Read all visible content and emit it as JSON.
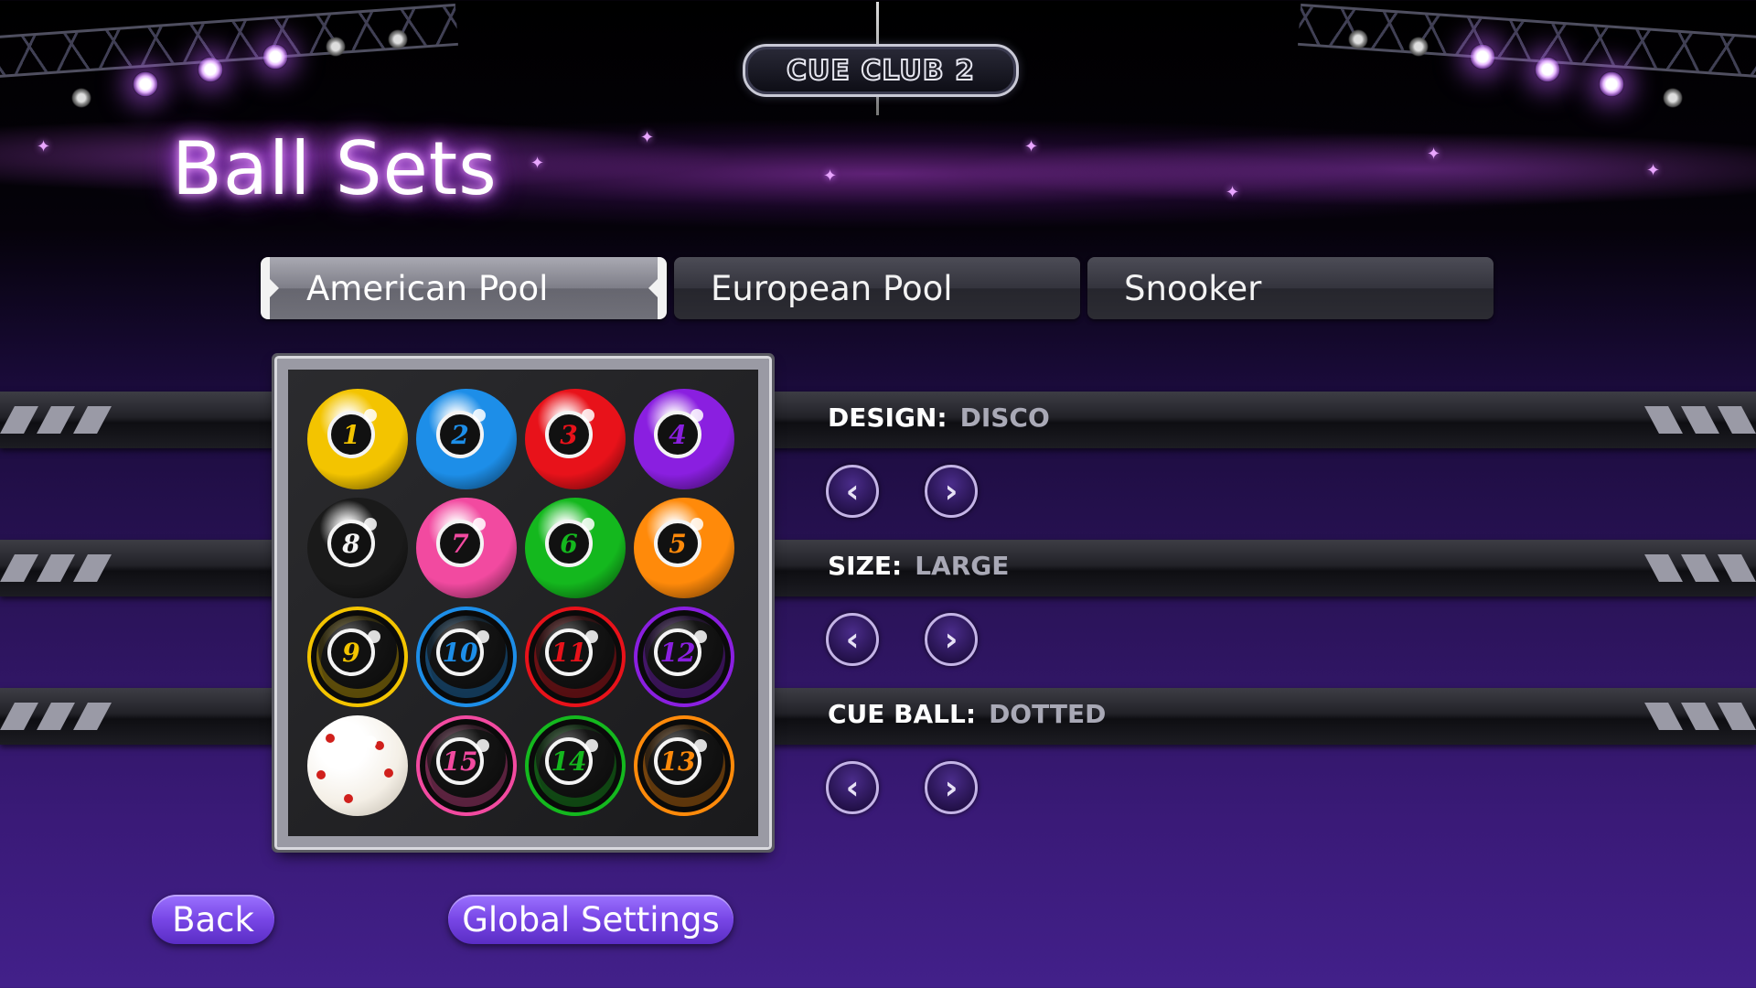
{
  "logo": {
    "text": "CUE CLUB 2"
  },
  "page_title": "Ball Sets",
  "tabs": [
    {
      "label": "American Pool",
      "active": true
    },
    {
      "label": "European Pool",
      "active": false
    },
    {
      "label": "Snooker",
      "active": false
    }
  ],
  "options": {
    "design": {
      "label": "DESIGN:",
      "value": "DISCO"
    },
    "size": {
      "label": "SIZE:",
      "value": "LARGE"
    },
    "cue_ball": {
      "label": "CUE BALL:",
      "value": "DOTTED"
    }
  },
  "arrows": {
    "prev": "‹",
    "next": "›"
  },
  "balls": [
    {
      "num": "1",
      "style": "solid",
      "color": "#f3c400"
    },
    {
      "num": "2",
      "style": "solid",
      "color": "#1d8ee8"
    },
    {
      "num": "3",
      "style": "solid",
      "color": "#e8121a"
    },
    {
      "num": "4",
      "style": "solid",
      "color": "#8a1fe0"
    },
    {
      "num": "8",
      "style": "solid",
      "color": "#1a1a1a"
    },
    {
      "num": "7",
      "style": "solid",
      "color": "#f24aa0"
    },
    {
      "num": "6",
      "style": "solid",
      "color": "#14b81e"
    },
    {
      "num": "5",
      "style": "solid",
      "color": "#ff8a0a"
    },
    {
      "num": "9",
      "style": "stripe",
      "color": "#f3c400"
    },
    {
      "num": "10",
      "style": "stripe",
      "color": "#1d8ee8"
    },
    {
      "num": "11",
      "style": "stripe",
      "color": "#e8121a"
    },
    {
      "num": "12",
      "style": "stripe",
      "color": "#8a1fe0"
    },
    {
      "num": "",
      "style": "cue",
      "color": "#f4efe6"
    },
    {
      "num": "15",
      "style": "stripe",
      "color": "#f24aa0"
    },
    {
      "num": "14",
      "style": "stripe",
      "color": "#14b81e"
    },
    {
      "num": "13",
      "style": "stripe",
      "color": "#ff8a0a"
    }
  ],
  "buttons": {
    "back": "Back",
    "global_settings": "Global Settings"
  },
  "colors": {
    "accent": "#7846e6",
    "title_glow": "#c060ff"
  }
}
